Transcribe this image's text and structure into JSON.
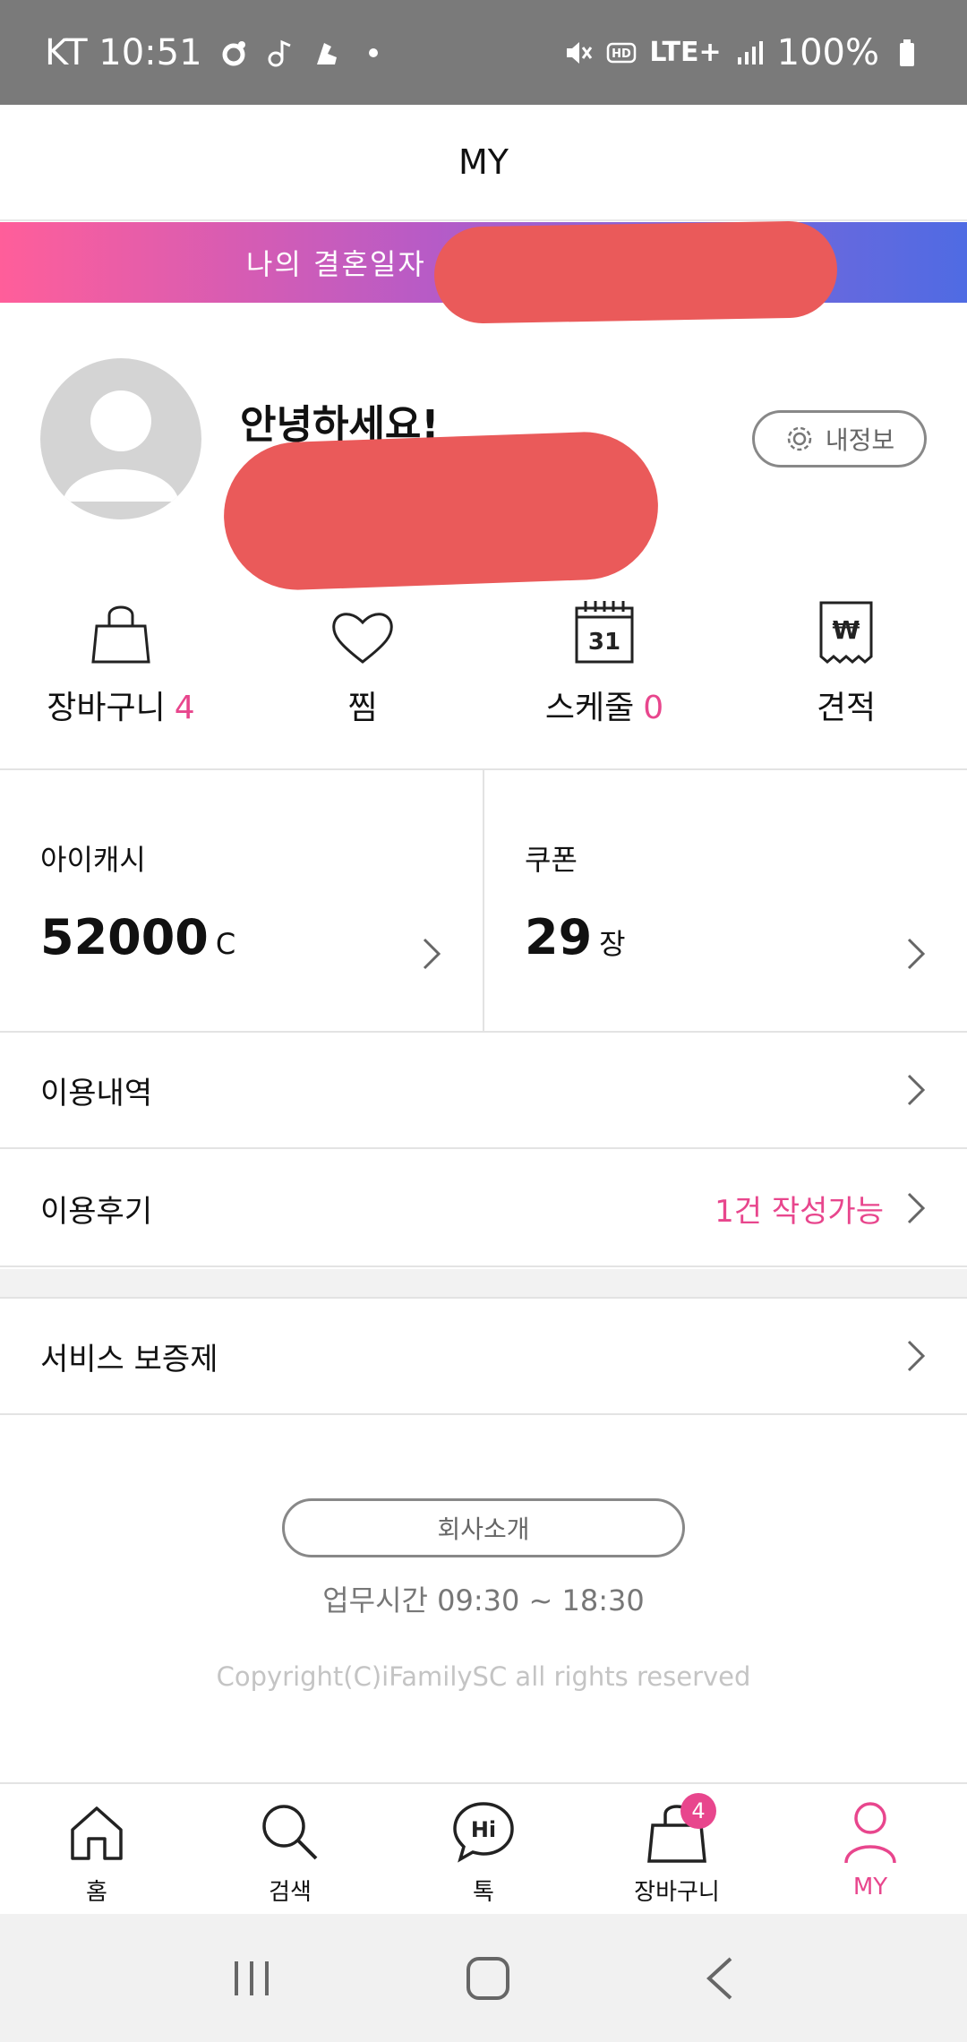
{
  "status_bar": {
    "carrier_time": "KT 10:51",
    "battery": "100%",
    "network": "LTE+"
  },
  "header": {
    "title": "MY"
  },
  "banner": {
    "label": "나의 결혼일자"
  },
  "profile": {
    "greeting": "안녕하세요!",
    "my_info_button": "내정보"
  },
  "quick_menu": [
    {
      "label": "장바구니",
      "count": "4",
      "icon": "shopping-bag-icon"
    },
    {
      "label": "찜",
      "count": "",
      "icon": "heart-icon"
    },
    {
      "label": "스케줄",
      "count": "0",
      "icon": "calendar-icon",
      "calendar_day": "31"
    },
    {
      "label": "견적",
      "count": "",
      "icon": "won-receipt-icon",
      "symbol": "₩"
    }
  ],
  "stats": {
    "cash": {
      "title": "아이캐시",
      "value": "52000",
      "unit": "C"
    },
    "coupon": {
      "title": "쿠폰",
      "value": "29",
      "unit": "장"
    }
  },
  "menu": {
    "history": "이용내역",
    "reviews": "이용후기",
    "reviews_status": "1건 작성가능",
    "guarantee": "서비스 보증제"
  },
  "footer": {
    "company_button": "회사소개",
    "hours": "업무시간 09:30 ~ 18:30",
    "copyright": "Copyright(C)iFamilySC all rights reserved"
  },
  "tabs": [
    {
      "label": "홈",
      "icon": "home-icon"
    },
    {
      "label": "검색",
      "icon": "search-icon"
    },
    {
      "label": "톡",
      "icon": "chat-hi-icon",
      "icon_text": "Hi"
    },
    {
      "label": "장바구니",
      "icon": "shopping-bag-icon",
      "badge": "4"
    },
    {
      "label": "MY",
      "icon": "person-icon"
    }
  ],
  "colors": {
    "accent": "#e8468d",
    "status_bar": "#7a7a7a",
    "banner_start": "#ff5e9a",
    "banner_end": "#4f6be3",
    "redaction": "#ea5a5a"
  }
}
